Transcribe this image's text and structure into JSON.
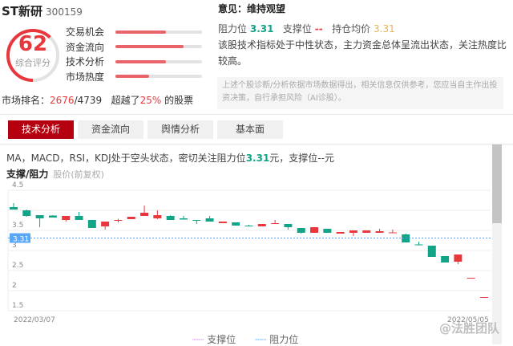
{
  "stock": {
    "name": "ST新研",
    "code": "300159"
  },
  "score": {
    "value": 62,
    "label": "综合评分",
    "max": 100
  },
  "metrics": [
    {
      "label": "交易机会",
      "fraction": 0.58
    },
    {
      "label": "资金流向",
      "fraction": 0.79
    },
    {
      "label": "技术分析",
      "fraction": 0.58
    },
    {
      "label": "市场热度",
      "fraction": 0.39
    }
  ],
  "rank": {
    "label": "市场排名：",
    "value": "2676",
    "total": "/4739",
    "beat_prefix": "超越了",
    "beat_pct": "25%",
    "beat_suffix": " 的股票"
  },
  "opinion": "意见：维持观望",
  "levels": {
    "resistance_label": "阻力位",
    "resistance": "3.31",
    "support_label": "支撑位",
    "support": "--",
    "cost_label": "持仓均价",
    "cost": "3.31"
  },
  "description": "该股技术指标处于中性状态，主力资金总体呈流出状态，关注热度比较高。",
  "notice": "上述个股诊断/分析依据市场数据得出，相关信息仅供参考，您应当自主作出投资决策，自行承担风险（AI诊股）。",
  "tabs": [
    {
      "label": "技术分析",
      "active": true
    },
    {
      "label": "资金流向"
    },
    {
      "label": "舆情分析"
    },
    {
      "label": "基本面"
    }
  ],
  "summary": {
    "prefix": "MA，MACD，RSI，KDJ处于空头状态，密切关注阻力位",
    "value": "3.31",
    "suffix": "元，支撑位--元"
  },
  "chart_title": "支撑/阻力",
  "chart_subtitle": "股价(前复权)",
  "watermark": "@法胜团队",
  "colors": {
    "up": "#e8383d",
    "down": "#12a486",
    "resistance": "#4a9ff5",
    "support": "#c77de8",
    "accent": "#b5000f"
  },
  "chart_data": {
    "type": "candlestick",
    "x_start": "2022/03/07",
    "x_end": "2022/05/05",
    "ylim": [
      1.5,
      4.5
    ],
    "yticks": [
      "4.5",
      "3.5",
      "3",
      "2.5",
      "2",
      "1.5"
    ],
    "ytick_values": [
      4.5,
      4,
      3.5,
      3,
      2.5,
      2,
      1.5
    ],
    "grid": true,
    "resistance": {
      "name": "阻力位",
      "value": 3.31,
      "label": "3.31"
    },
    "support": {
      "name": "支撑位",
      "value": null
    },
    "ohlc": [
      [
        4.08,
        4.18,
        4.02,
        4.02
      ],
      [
        4.0,
        4.02,
        3.84,
        3.86
      ],
      [
        3.88,
        3.88,
        3.58,
        3.8
      ],
      [
        3.87,
        3.88,
        3.82,
        3.82
      ],
      [
        3.76,
        3.86,
        3.72,
        3.86
      ],
      [
        3.86,
        3.96,
        3.76,
        3.76
      ],
      [
        3.76,
        3.76,
        3.56,
        3.56
      ],
      [
        3.6,
        3.72,
        3.52,
        3.72
      ],
      [
        3.75,
        3.79,
        3.7,
        3.76
      ],
      [
        3.78,
        3.84,
        3.78,
        3.84
      ],
      [
        3.86,
        4.12,
        3.86,
        3.94
      ],
      [
        3.8,
        4.0,
        3.78,
        3.88
      ],
      [
        3.86,
        3.88,
        3.76,
        3.76
      ],
      [
        3.8,
        3.86,
        3.77,
        3.77
      ],
      [
        3.76,
        3.76,
        3.66,
        3.75
      ],
      [
        3.8,
        3.86,
        3.72,
        3.72
      ],
      [
        3.68,
        3.72,
        3.68,
        3.72
      ],
      [
        3.7,
        3.7,
        3.62,
        3.62
      ],
      [
        3.62,
        3.64,
        3.6,
        3.61
      ],
      [
        3.6,
        3.66,
        3.6,
        3.66
      ],
      [
        3.67,
        3.76,
        3.66,
        3.68
      ],
      [
        3.66,
        3.66,
        3.52,
        3.58
      ],
      [
        3.56,
        3.56,
        3.42,
        3.44
      ],
      [
        3.44,
        3.58,
        3.44,
        3.58
      ],
      [
        3.54,
        3.54,
        3.44,
        3.44
      ],
      [
        3.42,
        3.46,
        3.42,
        3.46
      ],
      [
        3.44,
        3.5,
        3.36,
        3.5
      ],
      [
        3.44,
        3.5,
        3.44,
        3.5
      ],
      [
        3.44,
        3.54,
        3.44,
        3.48
      ],
      [
        3.44,
        3.52,
        3.44,
        3.45
      ],
      [
        3.4,
        3.42,
        3.2,
        3.2
      ],
      [
        3.15,
        3.22,
        3.14,
        3.14
      ],
      [
        3.12,
        3.12,
        2.84,
        2.84
      ],
      [
        2.86,
        2.86,
        2.7,
        2.7
      ],
      [
        2.72,
        2.9,
        2.66,
        2.9
      ],
      [
        2.32,
        2.32,
        2.32,
        2.32
      ],
      [
        1.84,
        1.84,
        1.84,
        1.84
      ]
    ]
  }
}
